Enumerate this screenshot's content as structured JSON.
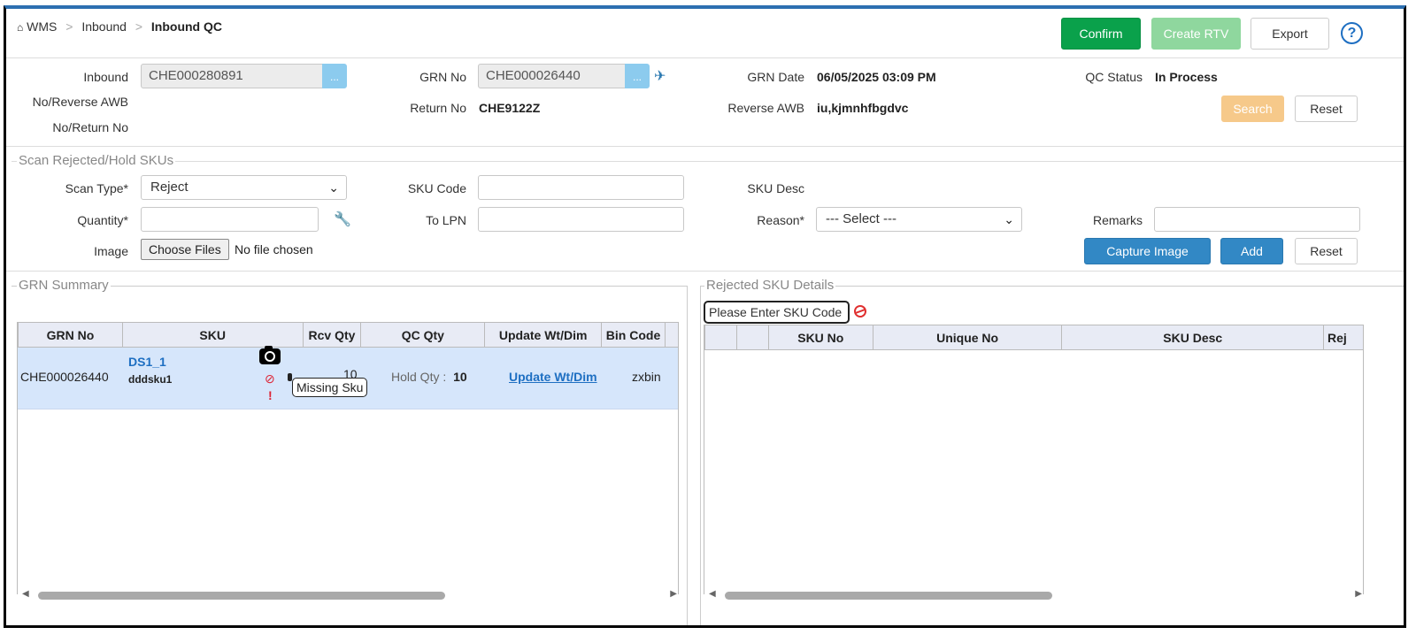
{
  "breadcrumb": {
    "home": "WMS",
    "sep": ">",
    "level1": "Inbound",
    "current": "Inbound QC"
  },
  "toolbar": {
    "confirm": "Confirm",
    "create_rtv": "Create RTV",
    "export": "Export",
    "help": "?"
  },
  "header": {
    "inbound_label_line1": "Inbound",
    "inbound_label_line2": "No/Reverse AWB",
    "inbound_label_line3": "No/Return No",
    "inbound_value": "CHE000280891",
    "ellipsis": "...",
    "grn_no_label": "GRN No",
    "grn_no_value": "CHE000026440",
    "return_no_label": "Return No",
    "return_no_value": "CHE9122Z",
    "grn_date_label": "GRN Date",
    "grn_date_value": "06/05/2025 03:09 PM",
    "reverse_awb_label": "Reverse AWB",
    "reverse_awb_value": "iu,kjmnhfbgdvc",
    "qc_status_label": "QC Status",
    "qc_status_value": "In Process",
    "search": "Search",
    "reset": "Reset"
  },
  "scan": {
    "legend": "Scan Rejected/Hold SKUs",
    "scan_type_label": "Scan Type*",
    "scan_type_value": "Reject",
    "sku_code_label": "SKU Code",
    "sku_desc_label": "SKU Desc",
    "quantity_label": "Quantity*",
    "to_lpn_label": "To LPN",
    "reason_label": "Reason*",
    "reason_value": "--- Select ---",
    "remarks_label": "Remarks",
    "image_label": "Image",
    "choose_files": "Choose Files",
    "no_file": "No file chosen",
    "capture_image": "Capture Image",
    "add": "Add",
    "reset": "Reset"
  },
  "grn_summary": {
    "legend": "GRN Summary",
    "columns": [
      "GRN No",
      "SKU",
      "Rcv Qty",
      "QC Qty",
      "Update Wt/Dim",
      "Bin Code"
    ],
    "row": {
      "grn_no": "CHE000026440",
      "sku_code": "DS1_1",
      "sku_name": "dddsku1",
      "rcv_qty": "10",
      "hold_label": "Hold Qty :",
      "hold_value": "10",
      "update_link": "Update Wt/Dim",
      "bin_code": "zxbin",
      "tooltip": "Missing Sku"
    }
  },
  "rejected": {
    "legend": "Rejected SKU Details",
    "search_placeholder": "Please Enter SKU Code",
    "columns": [
      "SKU No",
      "Unique No",
      "SKU Desc",
      "Rej"
    ]
  },
  "colors": {
    "confirm": "#0aa14b",
    "create_rtv": "#8fd79e",
    "blue": "#3288c5",
    "search": "#f6c98a",
    "selected_row": "#d6e6fb"
  }
}
